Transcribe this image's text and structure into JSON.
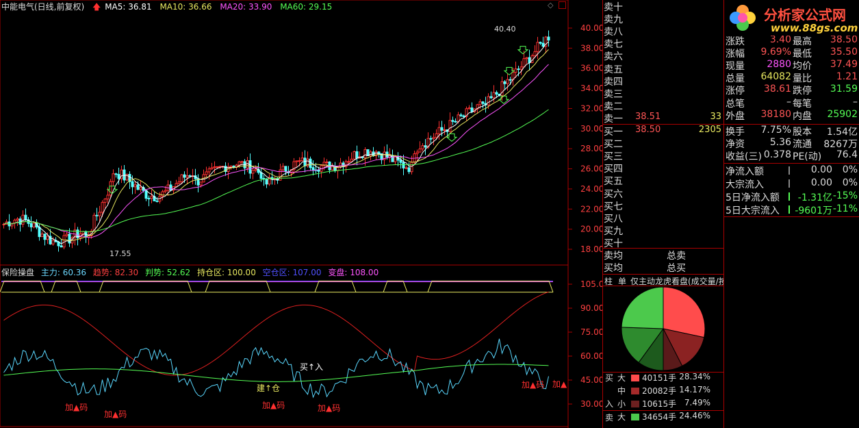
{
  "header": {
    "title": "中能电气(日线,前复权)",
    "ma5": "MA5: 36.81",
    "ma10": "MA10: 36.66",
    "ma20": "MA20: 33.90",
    "ma60": "MA60: 29.15"
  },
  "price_axis": [
    "40.00",
    "38.00",
    "36.00",
    "34.00",
    "32.00",
    "30.00",
    "28.00",
    "26.00",
    "24.00",
    "22.00",
    "20.00",
    "18.00"
  ],
  "price_annotations": {
    "high": "40.40",
    "low": "17.55"
  },
  "indicator_header": {
    "name": "保险操盘",
    "main_force": "主力: 60.36",
    "trend": "趋势: 82.30",
    "judge": "判势: 52.62",
    "hold": "持仓区: 100.00",
    "empty": "空仓区: 107.00",
    "change": "变盘: 108.00"
  },
  "indicator_axis": [
    "105.0",
    "90.00",
    "75.00",
    "60.00",
    "45.00",
    "30.00"
  ],
  "indicator_labels": {
    "buy": "买↑入",
    "build": "建↑仓",
    "add1": "加▲码",
    "add2": "加▲码",
    "add3": "加▲码",
    "add4": "加▲码",
    "add5": "加▲码",
    "add6": "加▲"
  },
  "order_book": {
    "sells": [
      "卖十",
      "卖九",
      "卖八",
      "卖七",
      "卖六",
      "卖五",
      "卖四",
      "卖三",
      "卖二",
      "卖一"
    ],
    "sell1_price": "38.51",
    "sell1_vol": "33",
    "buys": [
      "买一",
      "买二",
      "买三",
      "买四",
      "买五",
      "买六",
      "买七",
      "买八",
      "买九",
      "买十"
    ],
    "buy1_price": "38.50",
    "buy1_vol": "2305",
    "avg_sell": "卖均",
    "avg_buy": "买均",
    "total_sell": "总卖",
    "total_buy": "总买"
  },
  "stats": [
    {
      "k1": "涨跌",
      "v1": "3.40",
      "c1": "#ff5555",
      "k2": "最高",
      "v2": "38.50",
      "c2": "#ff5555"
    },
    {
      "k1": "涨幅",
      "v1": "9.69%",
      "c1": "#ff5555",
      "k2": "最低",
      "v2": "35.50",
      "c2": "#ff5555"
    },
    {
      "k1": "现量",
      "v1": "2880",
      "c1": "#ff55ff",
      "k2": "均价",
      "v2": "37.49",
      "c2": "#ff5555"
    },
    {
      "k1": "总量",
      "v1": "64082",
      "c1": "#e8e860",
      "k2": "量比",
      "v2": "1.21",
      "c2": "#ff5555"
    },
    {
      "k1": "涨停",
      "v1": "38.61",
      "c1": "#ff5555",
      "k2": "跌停",
      "v2": "31.59",
      "c2": "#55ff55"
    },
    {
      "k1": "总笔",
      "v1": "–",
      "c1": "#ddd",
      "k2": "每笔",
      "v2": "–",
      "c2": "#ddd"
    },
    {
      "k1": "外盘",
      "v1": "38180",
      "c1": "#ff5555",
      "k2": "内盘",
      "v2": "25902",
      "c2": "#55ff55"
    }
  ],
  "stats2": [
    {
      "k1": "换手",
      "v1": "7.75%",
      "c1": "#ddd",
      "k2": "股本",
      "v2": "1.54亿",
      "c2": "#ddd"
    },
    {
      "k1": "净资",
      "v1": "5.36",
      "c1": "#ddd",
      "k2": "流通",
      "v2": "8267万",
      "c2": "#ddd"
    },
    {
      "k1": "收益(三)",
      "v1": "0.378",
      "c1": "#ddd",
      "k2": "PE(动)",
      "v2": "76.4",
      "c2": "#ddd"
    }
  ],
  "flows": [
    {
      "k": "净流入额",
      "v": "0.00",
      "p": "0%",
      "c": "#ddd"
    },
    {
      "k": "大宗流入",
      "v": "0.00",
      "p": "0%",
      "c": "#ddd"
    },
    {
      "k": "5日净流入额",
      "v": "-1.31亿",
      "p": "-15%",
      "c": "#55ff55"
    },
    {
      "k": "5日大宗流入",
      "v": "-9601万",
      "p": "-11%",
      "c": "#55ff55"
    }
  ],
  "tabs": [
    "柱",
    "单",
    "仅主动",
    "龙虎看盘(成交量/按"
  ],
  "legend": {
    "buy_label": "买",
    "buy_label2": "入",
    "sell_label": "卖",
    "rows": [
      {
        "size": "大",
        "vol": "40151手",
        "pct": "28.34%",
        "color": "#ff4c4c"
      },
      {
        "size": "中",
        "vol": "20082手",
        "pct": "14.17%",
        "color": "#a52a2a"
      },
      {
        "size": "小",
        "vol": "10615手",
        "pct": "7.49%",
        "color": "#6b2020"
      },
      {
        "size": "大",
        "vol": "34654手",
        "pct": "24.46%",
        "color": "#4cc94c"
      }
    ]
  },
  "pie": [
    {
      "pct": 28.34,
      "color": "#ff4c4c"
    },
    {
      "pct": 14.17,
      "color": "#8b2222"
    },
    {
      "pct": 7.49,
      "color": "#5a1a1a"
    },
    {
      "pct": 10.0,
      "color": "#1d5a1d"
    },
    {
      "pct": 15.54,
      "color": "#2e8b2e"
    },
    {
      "pct": 24.46,
      "color": "#4cc94c"
    }
  ],
  "logo": {
    "text": "分析家公式网",
    "url": "www.88gs.com"
  }
}
